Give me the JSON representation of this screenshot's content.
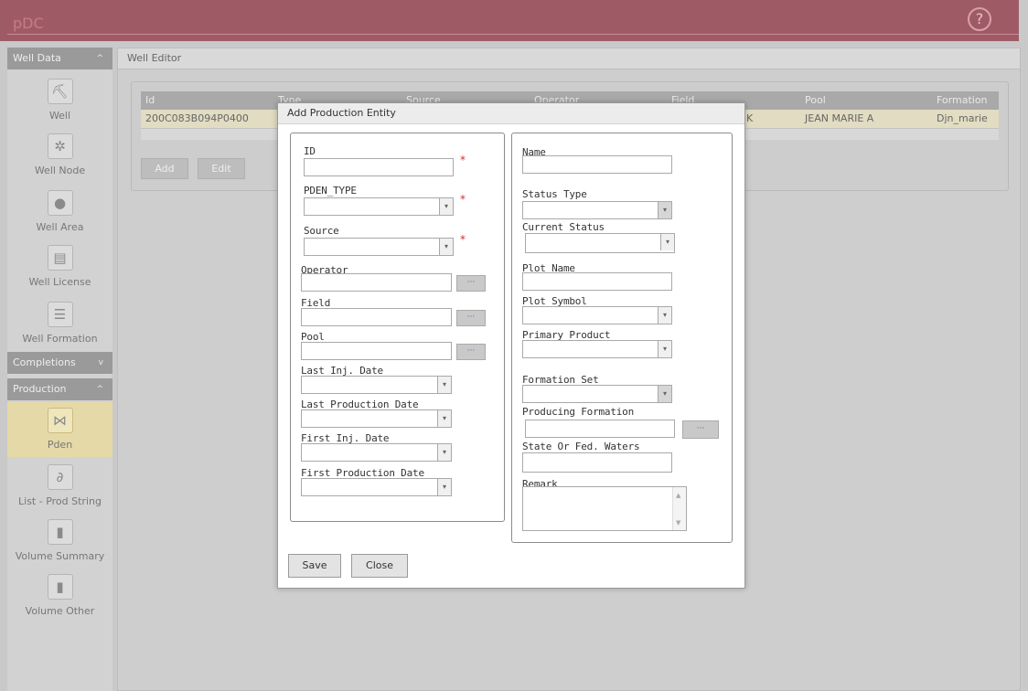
{
  "app": {
    "logo": "pDC",
    "help_icon": "help-circle-icon",
    "help_label": "?"
  },
  "sidebar": {
    "sections": [
      {
        "label": "Well Data",
        "chevron": "^"
      },
      {
        "label": "Completions",
        "chevron": "v"
      },
      {
        "label": "Production",
        "chevron": "^"
      }
    ],
    "items": [
      {
        "label": "Well",
        "icon": "pump-jack-icon",
        "glyph": "⛏"
      },
      {
        "label": "Well Node",
        "icon": "node-icon",
        "glyph": "✲"
      },
      {
        "label": "Well Area",
        "icon": "globe-icon",
        "glyph": "●"
      },
      {
        "label": "Well License",
        "icon": "document-icon",
        "glyph": "▤"
      },
      {
        "label": "Well Formation",
        "icon": "formation-icon",
        "glyph": "☰"
      },
      {
        "label": "Pden",
        "icon": "pden-icon",
        "glyph": "⋈"
      },
      {
        "label": "List - Prod String",
        "icon": "prod-string-icon",
        "glyph": "∂"
      },
      {
        "label": "Volume Summary",
        "icon": "bar-chart-icon",
        "glyph": "▮"
      },
      {
        "label": "Volume Other",
        "icon": "bar-chart-icon",
        "glyph": "▮"
      }
    ]
  },
  "main": {
    "title": "Well Editor",
    "grid": {
      "columns": [
        "Id",
        "Type",
        "Source",
        "Operator",
        "Field",
        "Pool",
        "Formation"
      ],
      "row": {
        "id": "200C083B094P0400",
        "field_tail": "K",
        "pool": "JEAN MARIE A",
        "formation": "Djn_marie"
      }
    },
    "buttons": {
      "add": "Add",
      "edit": "Edit"
    }
  },
  "dialog": {
    "title": "Add Production Entity",
    "left": {
      "id": "ID",
      "pden_type": "PDEN_TYPE",
      "source": "Source",
      "operator": "Operator",
      "field": "Field",
      "pool": "Pool",
      "last_inj_date": "Last Inj. Date",
      "last_production_date": "Last Production Date",
      "first_inj_date": "First Inj. Date",
      "first_production_date": "First Production Date"
    },
    "right": {
      "name": "Name",
      "status_type": "Status Type",
      "current_status": "Current Status",
      "plot_name": "Plot Name",
      "plot_symbol": "Plot Symbol",
      "primary_product": "Primary Product",
      "formation_set": "Formation Set",
      "producing_formation": "Producing Formation",
      "state_or_fed_waters": "State Or Fed. Waters",
      "remark": "Remark"
    },
    "required_mark": "*",
    "ellipsis": "···",
    "arrow": "▾",
    "save": "Save",
    "close": "Close"
  }
}
